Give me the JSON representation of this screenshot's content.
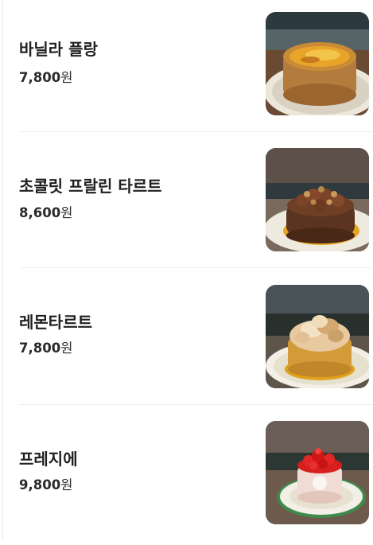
{
  "menu": {
    "items": [
      {
        "name": "바닐라 플랑",
        "price": "7,800",
        "currency": "원"
      },
      {
        "name": "초콜릿 프랄린 타르트",
        "price": "8,600",
        "currency": "원"
      },
      {
        "name": "레몬타르트",
        "price": "7,800",
        "currency": "원"
      },
      {
        "name": "프레지에",
        "price": "9,800",
        "currency": "원"
      }
    ]
  }
}
